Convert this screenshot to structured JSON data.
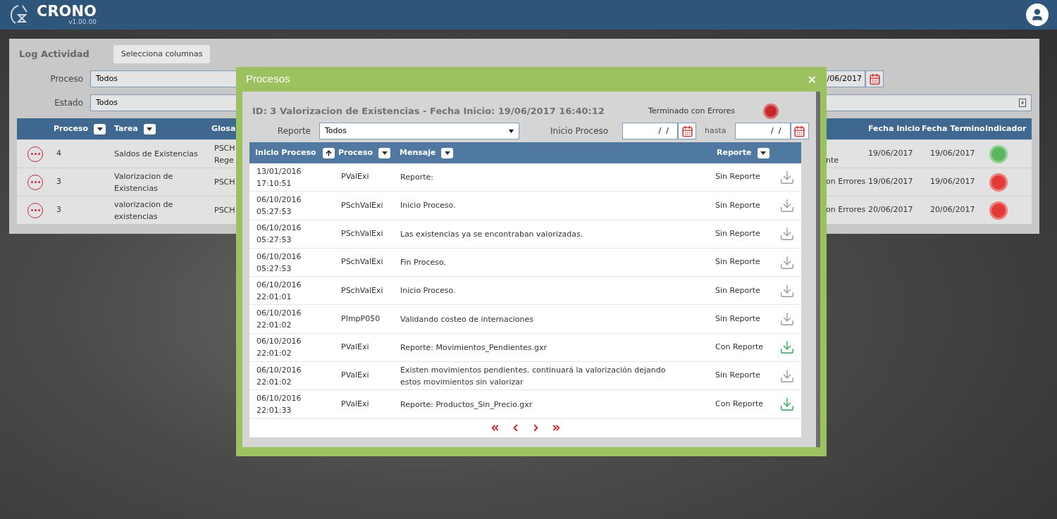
{
  "app": {
    "name": "CRONO",
    "version": "v1.00.00"
  },
  "page": {
    "title": "Log Actividad",
    "columns_button": "Selecciona columnas",
    "filters": [
      {
        "label": "Proceso",
        "value": "Todos"
      },
      {
        "label": "Estado",
        "value": "Todos"
      }
    ],
    "fin_date": "/06/2017",
    "table": {
      "columns": [
        {
          "label": "Proceso",
          "menu": true
        },
        {
          "label": "Tarea",
          "menu": true
        },
        {
          "label": "Glosa",
          "menu": false
        },
        {
          "label": "Fecha Inicio",
          "menu": false
        },
        {
          "label": "Fecha Termino",
          "menu": false
        },
        {
          "label": "Indicador",
          "menu": false
        }
      ],
      "rows": [
        {
          "proceso": "4",
          "tarea": "Saldos de Existencias",
          "glosa": "PSCH",
          "glosa_2": "Rege",
          "estado": "nte",
          "fecha_inicio": "19/06/2017",
          "fecha_termino": "19/06/2017",
          "color": "#5cb85c"
        },
        {
          "proceso": "3",
          "tarea": "Valorizacion de Existencias",
          "glosa": "PSCH",
          "estado": "on Errores",
          "fecha_inicio": "19/06/2017",
          "fecha_termino": "19/06/2017",
          "color": "#e53935"
        },
        {
          "proceso": "3",
          "tarea": "valorizacion de existencias",
          "glosa": "PSCH",
          "estado": "on Errores",
          "fecha_inicio": "20/06/2017",
          "fecha_termino": "20/06/2017",
          "color": "#e53935"
        }
      ]
    }
  },
  "modal": {
    "title": "Procesos",
    "close": "×",
    "heading": "ID: 3 Valorizacion de Existencias - Fecha Inicio: 19/06/2017 16:40:12",
    "status": {
      "text": "Terminado con Errores",
      "color": "#c62828"
    },
    "report_filter": {
      "label": "Reporte",
      "value": "Todos"
    },
    "date_filter": {
      "label": "Inicio Proceso",
      "from": "/  /",
      "separator": "hasta",
      "to": "/  /"
    },
    "columns": [
      {
        "label": "Inicio Proceso",
        "kind": "sort"
      },
      {
        "label": "Proceso",
        "kind": "menu"
      },
      {
        "label": "Mensaje",
        "kind": "menu"
      },
      {
        "label": "Reporte",
        "kind": "menu"
      }
    ],
    "rows": [
      {
        "date": "13/01/2016",
        "time": "17:10:51",
        "proceso": "PValExi",
        "mensaje": "Reporte:",
        "reporte": "Sin Reporte",
        "has_report": false
      },
      {
        "date": "06/10/2016",
        "time": "05:27:53",
        "proceso": "PSchValExi",
        "mensaje": "Inicio Proceso.",
        "reporte": "Sin Reporte",
        "has_report": false
      },
      {
        "date": "06/10/2016",
        "time": "05:27:53",
        "proceso": "PSchValExi",
        "mensaje": "Las existencias ya se encontraban valorizadas.",
        "reporte": "Sin Reporte",
        "has_report": false
      },
      {
        "date": "06/10/2016",
        "time": "05:27:53",
        "proceso": "PSchValExi",
        "mensaje": "Fin Proceso.",
        "reporte": "Sin Reporte",
        "has_report": false
      },
      {
        "date": "06/10/2016",
        "time": "22:01:01",
        "proceso": "PSchValExi",
        "mensaje": "Inicio Proceso.",
        "reporte": "Sin Reporte",
        "has_report": false
      },
      {
        "date": "06/10/2016",
        "time": "22:01:02",
        "proceso": "PImpP050",
        "mensaje": "Validando costeo de internaciones",
        "reporte": "Sin Reporte",
        "has_report": false
      },
      {
        "date": "06/10/2016",
        "time": "22:01:02",
        "proceso": "PValExi",
        "mensaje": "Reporte: Movimientos_Pendientes.gxr",
        "reporte": "Con Reporte",
        "has_report": true
      },
      {
        "date": "06/10/2016",
        "time": "22:01:02",
        "proceso": "PValExi",
        "mensaje": "Existen movimientos pendientes. continuará la valorización dejando estos movimientos sin valorizar",
        "reporte": "Sin Reporte",
        "has_report": false
      },
      {
        "date": "06/10/2016",
        "time": "22:01:33",
        "proceso": "PValExi",
        "mensaje": "Reporte: Productos_Sin_Precio.gxr",
        "reporte": "Con Reporte",
        "has_report": true
      }
    ]
  }
}
